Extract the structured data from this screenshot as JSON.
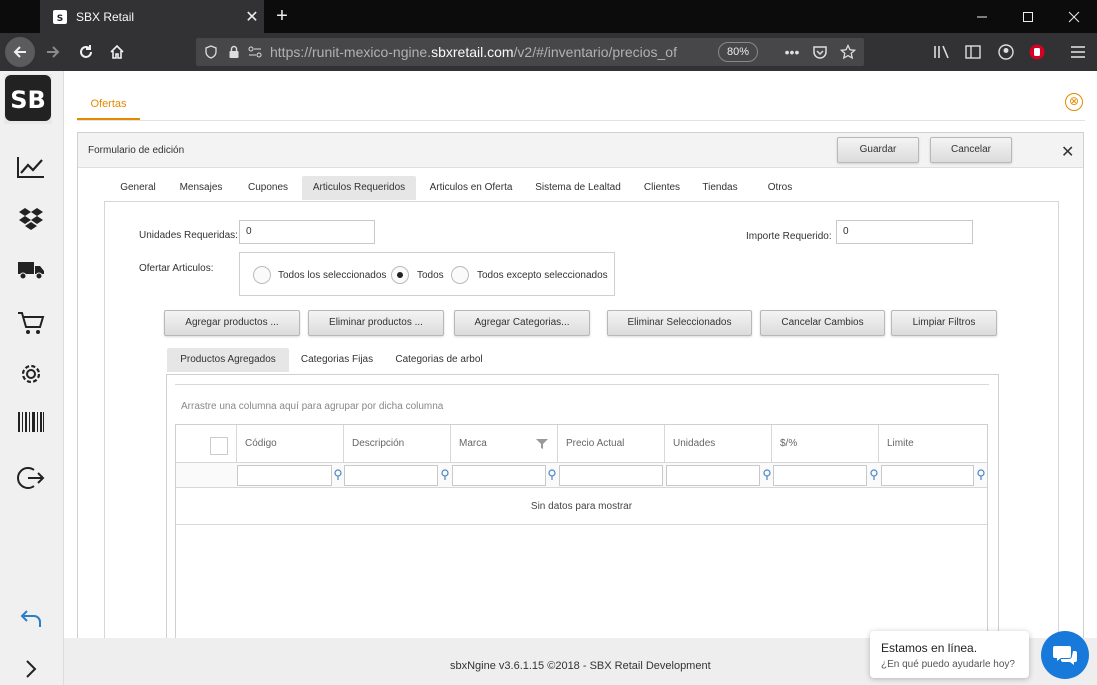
{
  "browser": {
    "tab_title": "SBX Retail",
    "url_prefix": "https://runit-mexico-ngine.",
    "url_domain": "sbxretail.com",
    "url_suffix": "/v2/#/inventario/precios_of",
    "zoom": "80%"
  },
  "page": {
    "tab": "Ofertas",
    "close_icon": "⊗"
  },
  "form": {
    "title": "Formulario de edición",
    "save_label": "Guardar",
    "cancel_label": "Cancelar",
    "close_label": "✕",
    "tabs": [
      "General",
      "Mensajes",
      "Cupones",
      "Articulos Requeridos",
      "Articulos en Oferta",
      "Sistema de Lealtad",
      "Clientes",
      "Tiendas",
      "Otros"
    ],
    "active_tab": "Articulos Requeridos"
  },
  "fields": {
    "units_label": "Unidades Requeridas:",
    "units_value": "0",
    "amount_label": "Importe Requerido:",
    "amount_value": "0",
    "offer_label": "Ofertar Articulos:",
    "radio_all_selected": "Todos los seleccionados",
    "radio_all": "Todos",
    "radio_all_except": "Todos excepto seleccionados",
    "radio_selected": "Todos"
  },
  "actions": {
    "add_products": "Agregar productos ...",
    "remove_products": "Eliminar productos ...",
    "add_categories": "Agregar Categorias...",
    "remove_selected": "Eliminar Seleccionados",
    "cancel_changes": "Cancelar Cambios",
    "clear_filters": "Limpiar Filtros"
  },
  "subtabs": [
    "Productos Agregados",
    "Categorias Fijas",
    "Categorias de arbol"
  ],
  "grid": {
    "group_hint": "Arrastre una columna aquí para agrupar por dicha columna",
    "columns": [
      "Código",
      "Descripción",
      "Marca",
      "Precio Actual",
      "Unidades",
      "$/%",
      "Limite"
    ],
    "empty_text": "Sin datos para mostrar"
  },
  "footer": {
    "text": "sbxNgine v3.6.1.15 ©2018 - SBX Retail Development"
  },
  "chat": {
    "title": "Estamos en línea.",
    "subtitle": "¿En qué puedo ayudarle hoy?"
  },
  "colors": {
    "accent": "#e38b00",
    "chat": "#1779d9"
  }
}
